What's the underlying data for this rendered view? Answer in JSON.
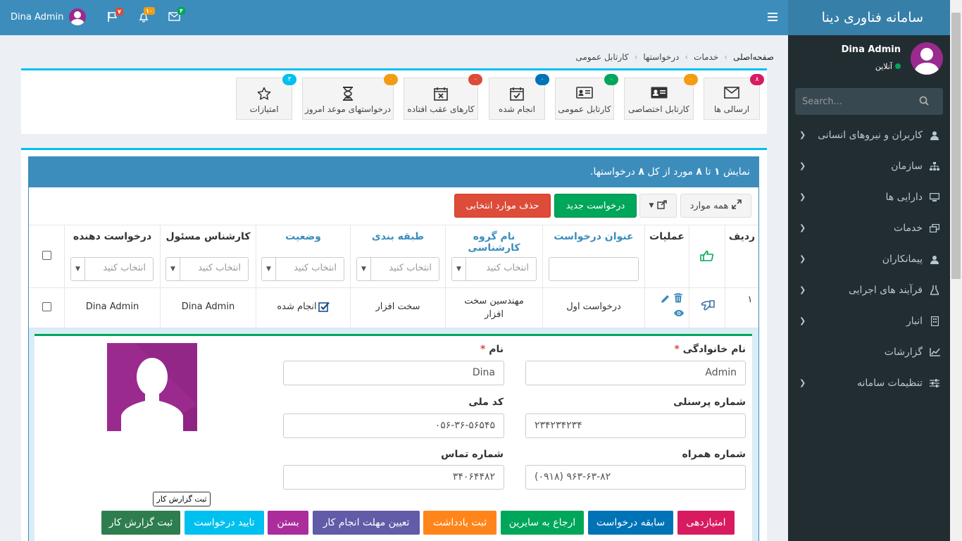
{
  "app": {
    "title": "سامانه فناوری دینا"
  },
  "user": {
    "name": "Dina Admin",
    "status": "آنلاین"
  },
  "sidebar": {
    "search_placeholder": "Search...",
    "items": [
      {
        "label": "کاربران و نیروهای انسانی",
        "icon": "user-icon"
      },
      {
        "label": "سازمان",
        "icon": "sitemap-icon"
      },
      {
        "label": "دارایی ها",
        "icon": "desktop-icon"
      },
      {
        "label": "خدمات",
        "icon": "window-restore-icon"
      },
      {
        "label": "پیمانکاران",
        "icon": "contractor-icon"
      },
      {
        "label": "فرآیند های اجرایی",
        "icon": "flask-icon"
      },
      {
        "label": "انبار",
        "icon": "building-icon"
      },
      {
        "label": "گزارشات",
        "icon": "line-chart-icon"
      },
      {
        "label": "تنظیمات سامانه",
        "icon": "sliders-icon"
      }
    ]
  },
  "header": {
    "user_name": "Dina Admin",
    "badges": {
      "flag": "۷",
      "bell": "۱۰",
      "mail": "۴"
    }
  },
  "breadcrumb": [
    "صفحه‌اصلی",
    "خدمات",
    "درخواستها",
    "کارتابل عمومی"
  ],
  "tiles": [
    {
      "label": "ارسالی ها",
      "badge": "۸",
      "badge_color": "#d81b60",
      "icon": "envelope-icon"
    },
    {
      "label": "کارتابل اختصاصی",
      "badge": "۰",
      "badge_color": "#f39c12",
      "icon": "id-card-icon"
    },
    {
      "label": "کارتابل عمومی",
      "badge": "۰",
      "badge_color": "#00a65a",
      "icon": "address-card-icon"
    },
    {
      "label": "انجام شده",
      "badge": "۰",
      "badge_color": "#0073b7",
      "icon": "calendar-check-icon"
    },
    {
      "label": "کارهای عقب افتاده",
      "badge": "۰",
      "badge_color": "#dd4b39",
      "icon": "calendar-times-icon"
    },
    {
      "label": "درخواستهای موعد امروز",
      "badge": "۰",
      "badge_color": "#f39c12",
      "icon": "hourglass-icon"
    },
    {
      "label": "امتیازات",
      "badge": "۳",
      "badge_color": "#00c0ef",
      "icon": "star-icon"
    }
  ],
  "panel": {
    "summary_prefix": "نمایش",
    "summary_from": "۱",
    "summary_to_word": "تا",
    "summary_to": "۸",
    "summary_mid": "مورد از کل",
    "summary_total": "۸",
    "summary_suffix": "درخواستها."
  },
  "toolbar": {
    "all_items": "همه موارد",
    "new_request": "درخواست جدید",
    "delete_selected": "حذف موارد انتخابی"
  },
  "table": {
    "columns": [
      "ردیف",
      "عملیات",
      "عنوان درخواست",
      "نام گروه کارشناسی",
      "طبقه بندی",
      "وضعیت",
      "کارشناس مسئول",
      "درخواست دهنده"
    ],
    "select_placeholder": "انتخاب کنید",
    "rows": [
      {
        "index": "۱",
        "title": "درخواست اول",
        "group_line1": "مهندسین سخت",
        "group_line2": "افزار",
        "category": "سخت افزار",
        "status": "انجام شده",
        "expert": "Dina Admin",
        "requester": "Dina Admin"
      }
    ]
  },
  "detail": {
    "last_name_label": "نام خانوادگی",
    "last_name_value": "Admin",
    "first_name_label": "نام",
    "first_name_value": "Dina",
    "personnel_label": "شماره پرسنلی",
    "personnel_value": "۲۳۴۲۳۴۲۳۴",
    "national_label": "کد ملی",
    "national_value": "۰۵۶-۳۶-۵۶۵۴۵",
    "mobile_label": "شماره همراه",
    "mobile_value": "(۰۹۱۸) ۹۶۳-۶۳-۸۲",
    "phone_label": "شماره تماس",
    "phone_value": "۳۴۰۶۴۴۸۲"
  },
  "actions": [
    {
      "label": "امتیازدهی",
      "color": "#d81b60"
    },
    {
      "label": "سابقه درخواست",
      "color": "#0073b7"
    },
    {
      "label": "ارجاع به سایرین",
      "color": "#00a65a"
    },
    {
      "label": "ثبت یادداشت",
      "color": "#ff851b"
    },
    {
      "label": "تعیین مهلت انجام کار",
      "color": "#605ca8"
    },
    {
      "label": "بستن",
      "color": "#ab2d9c"
    },
    {
      "label": "تایید درخواست",
      "color": "#00c0ef"
    },
    {
      "label": "ثبت گزارش کار",
      "color": "#2e7d4f"
    }
  ],
  "tooltip": "ثبت گزارش کار"
}
